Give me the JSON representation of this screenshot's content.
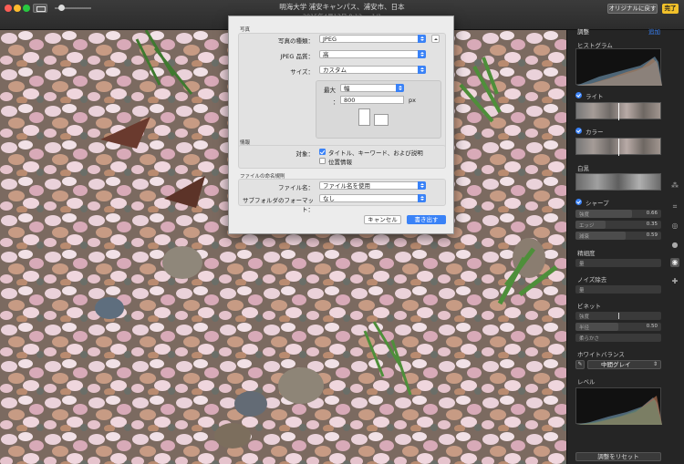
{
  "titlebar": {
    "title": "明海大学 浦安キャンパス、浦安市、日本",
    "subtitle": "2015年4月13日 8:12  —  1/1",
    "revert_label": "オリジナルに戻す",
    "done_label": "完了",
    "icons": [
      "close",
      "minimize",
      "zoom",
      "view-toggle",
      "zoom-slider"
    ]
  },
  "dialog": {
    "section_photo": "写真",
    "photo_kind_label": "写真の種類：",
    "photo_kind_value": "JPEG",
    "jpeg_quality_label": "JPEG 品質：",
    "jpeg_quality_value": "高",
    "size_label": "サイズ：",
    "size_value": "カスタム",
    "max_label": "最大",
    "max_value": "幅",
    "dim_sep": "：",
    "dim_value": "800",
    "dim_unit": "px",
    "section_info": "情報",
    "target_label": "対象：",
    "option_title": "タイトル、キーワード、および説明",
    "option_title_checked": true,
    "option_location": "位置情報",
    "option_location_checked": false,
    "section_filename": "ファイルの命名規則",
    "filename_label": "ファイル名：",
    "filename_value": "ファイル名を使用",
    "subfolder_label": "サブフォルダのフォーマット：",
    "subfolder_value": "なし",
    "cancel_label": "キャンセル",
    "export_label": "書き出す"
  },
  "sidebar": {
    "title": "調整",
    "add_label": "追加",
    "histogram_label": "ヒストグラム",
    "light_label": "ライト",
    "color_label": "カラー",
    "bw_label": "白黒",
    "sharpen_label": "シャープ",
    "sharpen": [
      {
        "label": "強度",
        "value": "0.66",
        "fraction": 0.66
      },
      {
        "label": "エッジ",
        "value": "0.35",
        "fraction": 0.35
      },
      {
        "label": "減衰",
        "value": "0.59",
        "fraction": 0.59
      }
    ],
    "definition_label": "精細度",
    "definition_amount_label": "量",
    "noise_label": "ノイズ除去",
    "noise_amount_label": "量",
    "vignette_label": "ビネット",
    "vignette": [
      {
        "label": "強度",
        "value": "",
        "fraction": 0.5
      },
      {
        "label": "半径",
        "value": "0.50",
        "fraction": 0.5
      },
      {
        "label": "柔らかさ",
        "value": "",
        "fraction": 0.0
      }
    ],
    "wb_label": "ホワイトバランス",
    "wb_value": "中間グレイ",
    "levels_label": "レベル",
    "reset_label": "調整をリセット"
  },
  "toolstrip": [
    "magic-wand-icon",
    "crop-icon",
    "filters-icon",
    "adjust-icon",
    "retouch-icon"
  ]
}
